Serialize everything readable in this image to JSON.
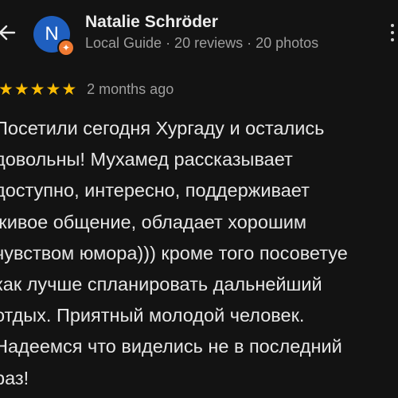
{
  "header": {
    "back_icon": "arrow-left-icon",
    "avatar_initial": "N",
    "badge_icon": "local-guide-badge-icon",
    "badge_symbol": "✦",
    "author_name": "Natalie Schröder",
    "author_meta": "Local Guide · 20 reviews · 20 photos",
    "menu_icon": "more-vertical-icon"
  },
  "review": {
    "rating": 5,
    "rating_max": 5,
    "star_symbol": "★",
    "date": "2 months ago",
    "text": "Посетили сегодня Хургаду и остались\nдовольны! Мухамед рассказывает\nдоступно, интересно, поддерживает\nживое общение, обладает хорошим\nчувством юмора))) кроме того посоветуе\nкак лучше спланировать дальнейший\nотдых. Приятный молодой человек.\nНадеемся что виделись не в последний\nраз!"
  },
  "colors": {
    "background": "#131313",
    "star": "#fbbc04",
    "avatar": "#1f5fbf",
    "badge": "#f07a32",
    "secondary_text": "#9e9e9e"
  }
}
